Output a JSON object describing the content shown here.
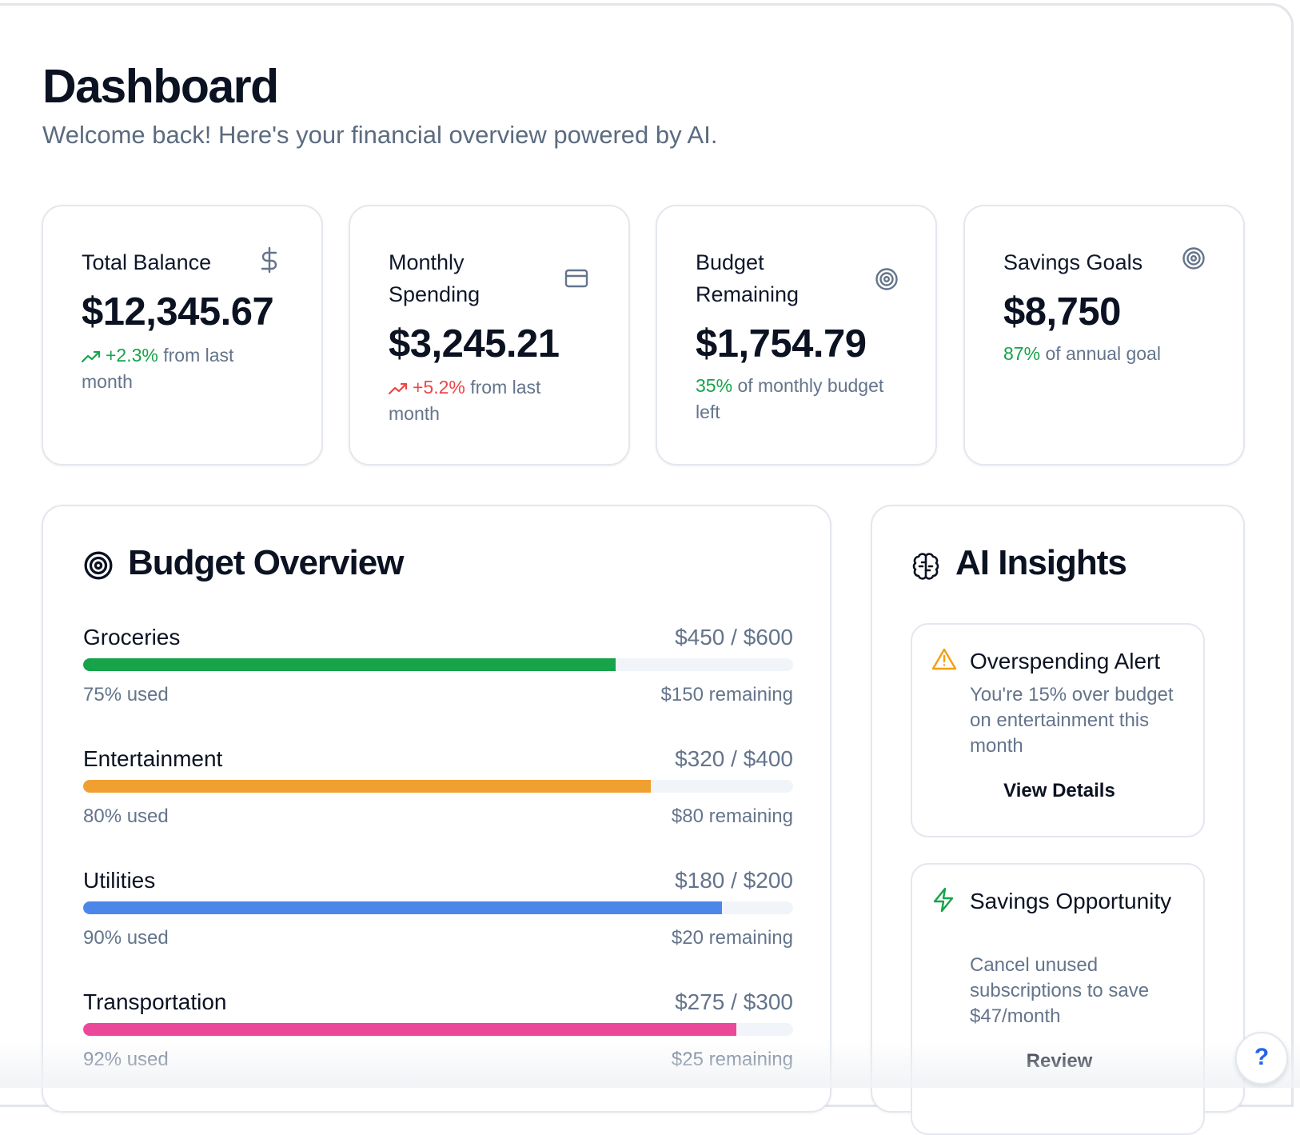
{
  "header": {
    "title": "Dashboard",
    "subtitle": "Welcome back! Here's your financial overview powered by AI."
  },
  "stats": [
    {
      "label": "Total Balance",
      "value": "$12,345.67",
      "change": "+2.3%",
      "change_suffix": "from last month",
      "icon": "dollar-icon"
    },
    {
      "label": "Monthly Spending",
      "value": "$3,245.21",
      "change": "+5.2%",
      "change_suffix": "from last month",
      "icon": "credit-card-icon"
    },
    {
      "label": "Budget Remaining",
      "value": "$1,754.79",
      "highlight": "35%",
      "note_suffix": "of monthly budget left",
      "icon": "target-icon"
    },
    {
      "label": "Savings Goals",
      "value": "$8,750",
      "highlight": "87%",
      "note_suffix": "of annual goal",
      "icon": "target-icon"
    }
  ],
  "budget": {
    "title": "Budget Overview",
    "icon": "target-icon",
    "items": [
      {
        "category": "Groceries",
        "amount": "$450 / $600",
        "used": "75% used",
        "remaining": "$150 remaining",
        "fraction": 0.75,
        "color": "#16a34a"
      },
      {
        "category": "Entertainment",
        "amount": "$320 / $400",
        "used": "80% used",
        "remaining": "$80 remaining",
        "fraction": 0.8,
        "color": "#f0a030"
      },
      {
        "category": "Utilities",
        "amount": "$180 / $200",
        "used": "90% used",
        "remaining": "$20 remaining",
        "fraction": 0.9,
        "color": "#4a87e8"
      },
      {
        "category": "Transportation",
        "amount": "$275 / $300",
        "used": "92% used",
        "remaining": "$25 remaining",
        "fraction": 0.92,
        "color": "#ec4899"
      }
    ]
  },
  "insights": {
    "title": "AI Insights",
    "icon": "brain-icon",
    "items": [
      {
        "title": "Overspending Alert",
        "description": "You're 15% over budget on entertainment this month",
        "action": "View Details",
        "icon": "warning-icon",
        "color": "#f59e0b"
      },
      {
        "title": "Savings Opportunity",
        "description": "Cancel unused subscriptions to save $47/month",
        "action": "Review",
        "icon": "lightning-icon",
        "color": "#16a34a"
      }
    ]
  },
  "help": {
    "label": "?"
  },
  "colors": {
    "positive": "#16a34a",
    "negative": "#ef4444",
    "muted": "#64748b"
  }
}
